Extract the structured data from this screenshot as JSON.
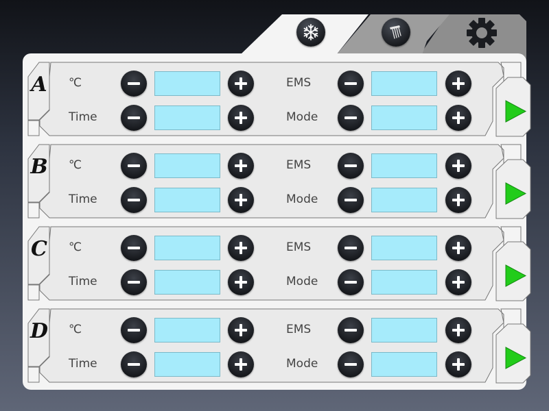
{
  "tabs": [
    {
      "name": "freeze",
      "icon": "snowflake-icon",
      "active": true
    },
    {
      "name": "shower",
      "icon": "shower-head-icon",
      "active": false
    },
    {
      "name": "settings",
      "icon": "gear-icon",
      "active": false
    }
  ],
  "colors": {
    "field_fill": "#a6ebfb",
    "play_green": "#22cc1a",
    "button_dark": "#15171b",
    "panel": "#f4f4f4"
  },
  "labels": {
    "temperature": "℃",
    "time": "Time",
    "ems": "EMS",
    "mode": "Mode"
  },
  "channels": [
    {
      "id": "A",
      "temperature": "",
      "time": "",
      "ems": "",
      "mode": ""
    },
    {
      "id": "B",
      "temperature": "",
      "time": "",
      "ems": "",
      "mode": ""
    },
    {
      "id": "C",
      "temperature": "",
      "time": "",
      "ems": "",
      "mode": ""
    },
    {
      "id": "D",
      "temperature": "",
      "time": "",
      "ems": "",
      "mode": ""
    }
  ]
}
